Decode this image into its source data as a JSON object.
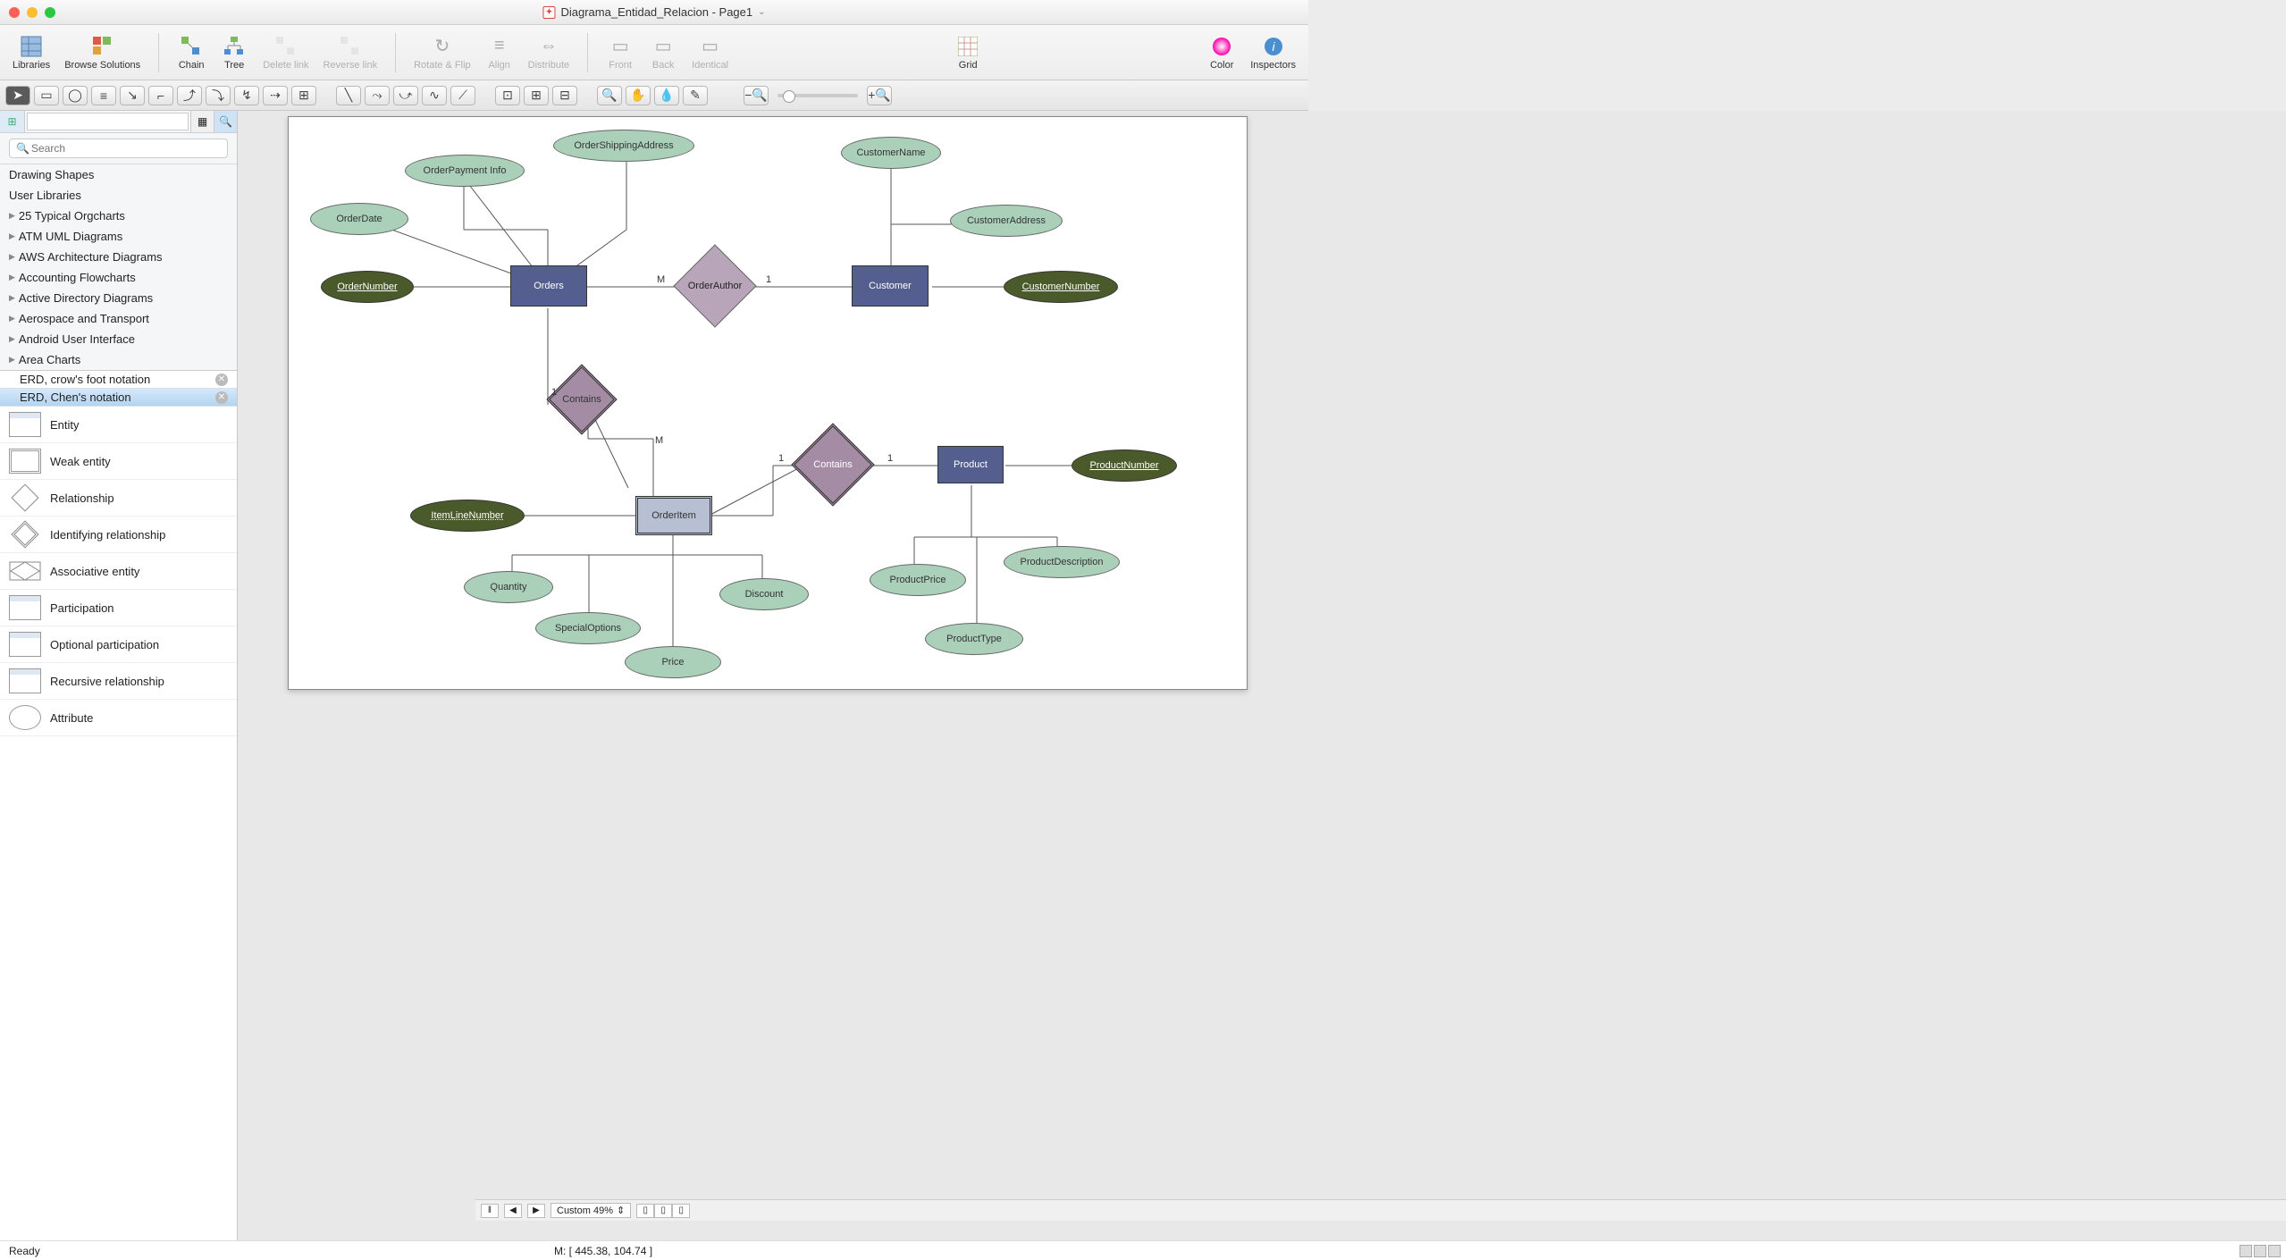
{
  "window": {
    "title": "Diagrama_Entidad_Relacion - Page1"
  },
  "toolbar": {
    "libraries": "Libraries",
    "browse": "Browse Solutions",
    "chain": "Chain",
    "tree": "Tree",
    "delete_link": "Delete link",
    "reverse_link": "Reverse link",
    "rotate_flip": "Rotate & Flip",
    "align": "Align",
    "distribute": "Distribute",
    "front": "Front",
    "back": "Back",
    "identical": "Identical",
    "grid": "Grid",
    "color": "Color",
    "inspectors": "Inspectors"
  },
  "sidebar": {
    "search_placeholder": "Search",
    "categories": [
      "Drawing Shapes",
      "User Libraries",
      "25 Typical Orgcharts",
      "ATM UML Diagrams",
      "AWS Architecture Diagrams",
      "Accounting Flowcharts",
      "Active Directory Diagrams",
      "Aerospace and Transport",
      "Android User Interface",
      "Area Charts"
    ],
    "tabs": [
      {
        "label": "ERD, crow's foot notation",
        "selected": false
      },
      {
        "label": "ERD, Chen's notation",
        "selected": true
      }
    ],
    "stencils": [
      "Entity",
      "Weak entity",
      "Relationship",
      "Identifying relationship",
      "Associative entity",
      "Participation",
      "Optional participation",
      "Recursive relationship",
      "Attribute"
    ]
  },
  "diagram": {
    "entities": {
      "orders": "Orders",
      "customer": "Customer",
      "orderitem": "OrderItem",
      "product": "Product"
    },
    "relationships": {
      "orderauthor": "OrderAuthor",
      "contains1": "Contains",
      "contains2": "Contains"
    },
    "attributes": {
      "orderdate": "OrderDate",
      "orderpayment": "OrderPayment Info",
      "ordershipping": "OrderShippingAddress",
      "ordernumber": "OrderNumber",
      "customername": "CustomerName",
      "customeraddress": "CustomerAddress",
      "customernumber": "CustomerNumber",
      "itemlinenumber": "ItemLineNumber",
      "quantity": "Quantity",
      "specialoptions": "SpecialOptions",
      "price": "Price",
      "discount": "Discount",
      "productnumber": "ProductNumber",
      "productdescription": "ProductDescription",
      "productprice": "ProductPrice",
      "producttype": "ProductType"
    },
    "cardinalities": {
      "m": "M",
      "one": "1"
    }
  },
  "bottom": {
    "zoom": "Custom 49%"
  },
  "status": {
    "ready": "Ready",
    "coords": "M: [ 445.38, 104.74 ]"
  }
}
